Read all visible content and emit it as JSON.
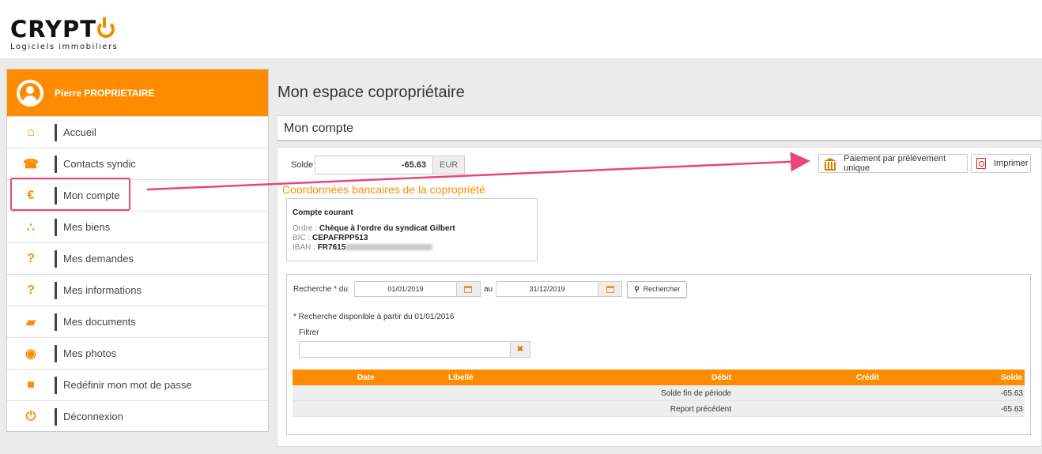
{
  "brand": {
    "name": "CRYPT",
    "subtitle": "Logiciels immobiliers"
  },
  "colors": {
    "accent": "#ff8c00",
    "highlight": "#e8467a"
  },
  "user": {
    "name": "Pierre PROPRIETAIRE"
  },
  "nav": [
    {
      "label": "Accueil",
      "icon": "home-icon",
      "glyph": "⌂"
    },
    {
      "label": "Contacts syndic",
      "icon": "phone-icon",
      "glyph": "☎"
    },
    {
      "label": "Mon compte",
      "icon": "euro-icon",
      "glyph": "€"
    },
    {
      "label": "Mes biens",
      "icon": "sitemap-icon",
      "glyph": "∴"
    },
    {
      "label": "Mes demandes",
      "icon": "question-icon",
      "glyph": "?"
    },
    {
      "label": "Mes informations",
      "icon": "question-icon",
      "glyph": "?"
    },
    {
      "label": "Mes documents",
      "icon": "folder-open-icon",
      "glyph": "▰"
    },
    {
      "label": "Mes photos",
      "icon": "camera-icon",
      "glyph": "◉"
    },
    {
      "label": "Redéfinir mon mot de passe",
      "icon": "lock-icon",
      "glyph": "■"
    },
    {
      "label": "Déconnexion",
      "icon": "power-icon",
      "glyph": "⏻"
    }
  ],
  "page": {
    "title": "Mon espace copropriétaire",
    "section": "Mon compte"
  },
  "balance": {
    "label": "Solde",
    "value": "-65.63",
    "currency": "EUR"
  },
  "actions": {
    "pay": "Paiement par prélèvement unique",
    "print": "Imprimer"
  },
  "bank": {
    "title": "Coordonnées bancaires de la copropriété",
    "account": "Compte courant",
    "ordre_label": "Ordre :",
    "ordre": "Chèque à l'ordre du syndicat Gilbert",
    "bic_label": "BIC :",
    "bic": "CEPAFRPP513",
    "iban_label": "IBAN :",
    "iban": "FR7615"
  },
  "search": {
    "label": "Recherche * du",
    "from": "01/01/2019",
    "to_label": "au",
    "to": "31/12/2019",
    "button": "Rechercher",
    "note": "* Recherche disponible à partir du 01/01/2016",
    "filter_label": "Filtrer",
    "filter_value": ""
  },
  "table": {
    "columns": [
      "Date",
      "Libellé",
      "Débit",
      "Crédit",
      "Solde"
    ],
    "rows": [
      {
        "date": "",
        "libelle": "",
        "debit": "Solde fin de période",
        "credit": "",
        "solde": "-65.63"
      },
      {
        "date": "",
        "libelle": "",
        "debit": "Report précédent",
        "credit": "",
        "solde": "-65.63"
      }
    ]
  }
}
